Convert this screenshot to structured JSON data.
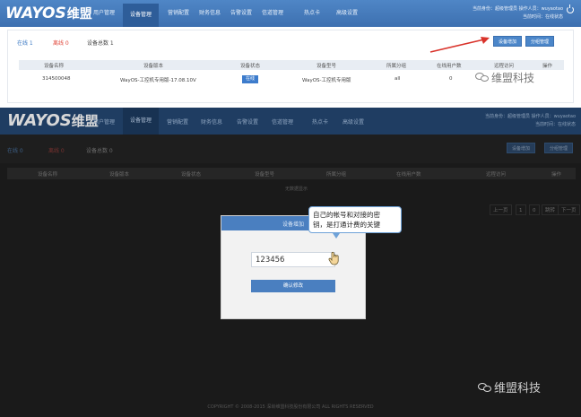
{
  "top": {
    "logo": "WAYOS",
    "logo_cn": "维盟",
    "nav": [
      "用户管理",
      "设备管理",
      "营销配置",
      "财务信息",
      "告警设置",
      "信道管理",
      "热点卡",
      "高级设置"
    ],
    "user_info_line1": "当前身份：超级管理员  操作人员：wuyaotao",
    "user_info_line2": "当前时间：在线状态",
    "stats": {
      "online": "在线 1",
      "offline": "离线 0",
      "total": "设备总数 1"
    },
    "buttons": {
      "add": "设备增加",
      "group": "分组管理"
    },
    "table_headers": [
      "设备名称",
      "设备版本",
      "设备状态",
      "设备型号",
      "所属分组",
      "在线用户数",
      "远程访问",
      "操作"
    ],
    "row": {
      "name": "314500048",
      "version": "WayOS-工控机专用版-17.08.10V",
      "status": "在线",
      "model": "WayOS-工控机专用版",
      "group": "all",
      "users": "0"
    }
  },
  "bottom": {
    "logo": "WAYOS",
    "logo_cn": "维盟",
    "nav": [
      "用户管理",
      "设备管理",
      "营销配置",
      "财务信息",
      "告警设置",
      "信道管理",
      "热点卡",
      "高级设置"
    ],
    "user_info_line1": "当前身份：超级管理员  操作人员：wuyaotao",
    "user_info_line2": "当前时间：在线状态",
    "stats": {
      "online": "在线 0",
      "offline": "离线 0",
      "total": "设备总数 0"
    },
    "buttons": {
      "add": "设备增加",
      "group": "分组管理"
    },
    "table_headers": [
      "设备名称",
      "设备版本",
      "设备状态",
      "设备型号",
      "所属分组",
      "在线用户数",
      "远程访问",
      "操作"
    ],
    "no_data": "无数据显示",
    "pager": [
      "上一页",
      "1",
      "0",
      "跳转",
      "下一页"
    ],
    "footer": "COPYRIGHT © 2008-2015 深圳维盟科技股份有限公司 ALL RIGHTS RESERVED",
    "modal": {
      "title": "设备增加",
      "input_value": "123456",
      "confirm": "确认修改"
    },
    "tooltip": {
      "line1": "自己的帐号和对接的密",
      "line2": "钥，是打通计费的关键"
    }
  },
  "watermark": "维盟科技",
  "colors": {
    "nav_blue": "#4f86c6",
    "accent": "#4a7fc0",
    "offline_red": "#e0463a",
    "arrow_red": "#d9332b"
  }
}
